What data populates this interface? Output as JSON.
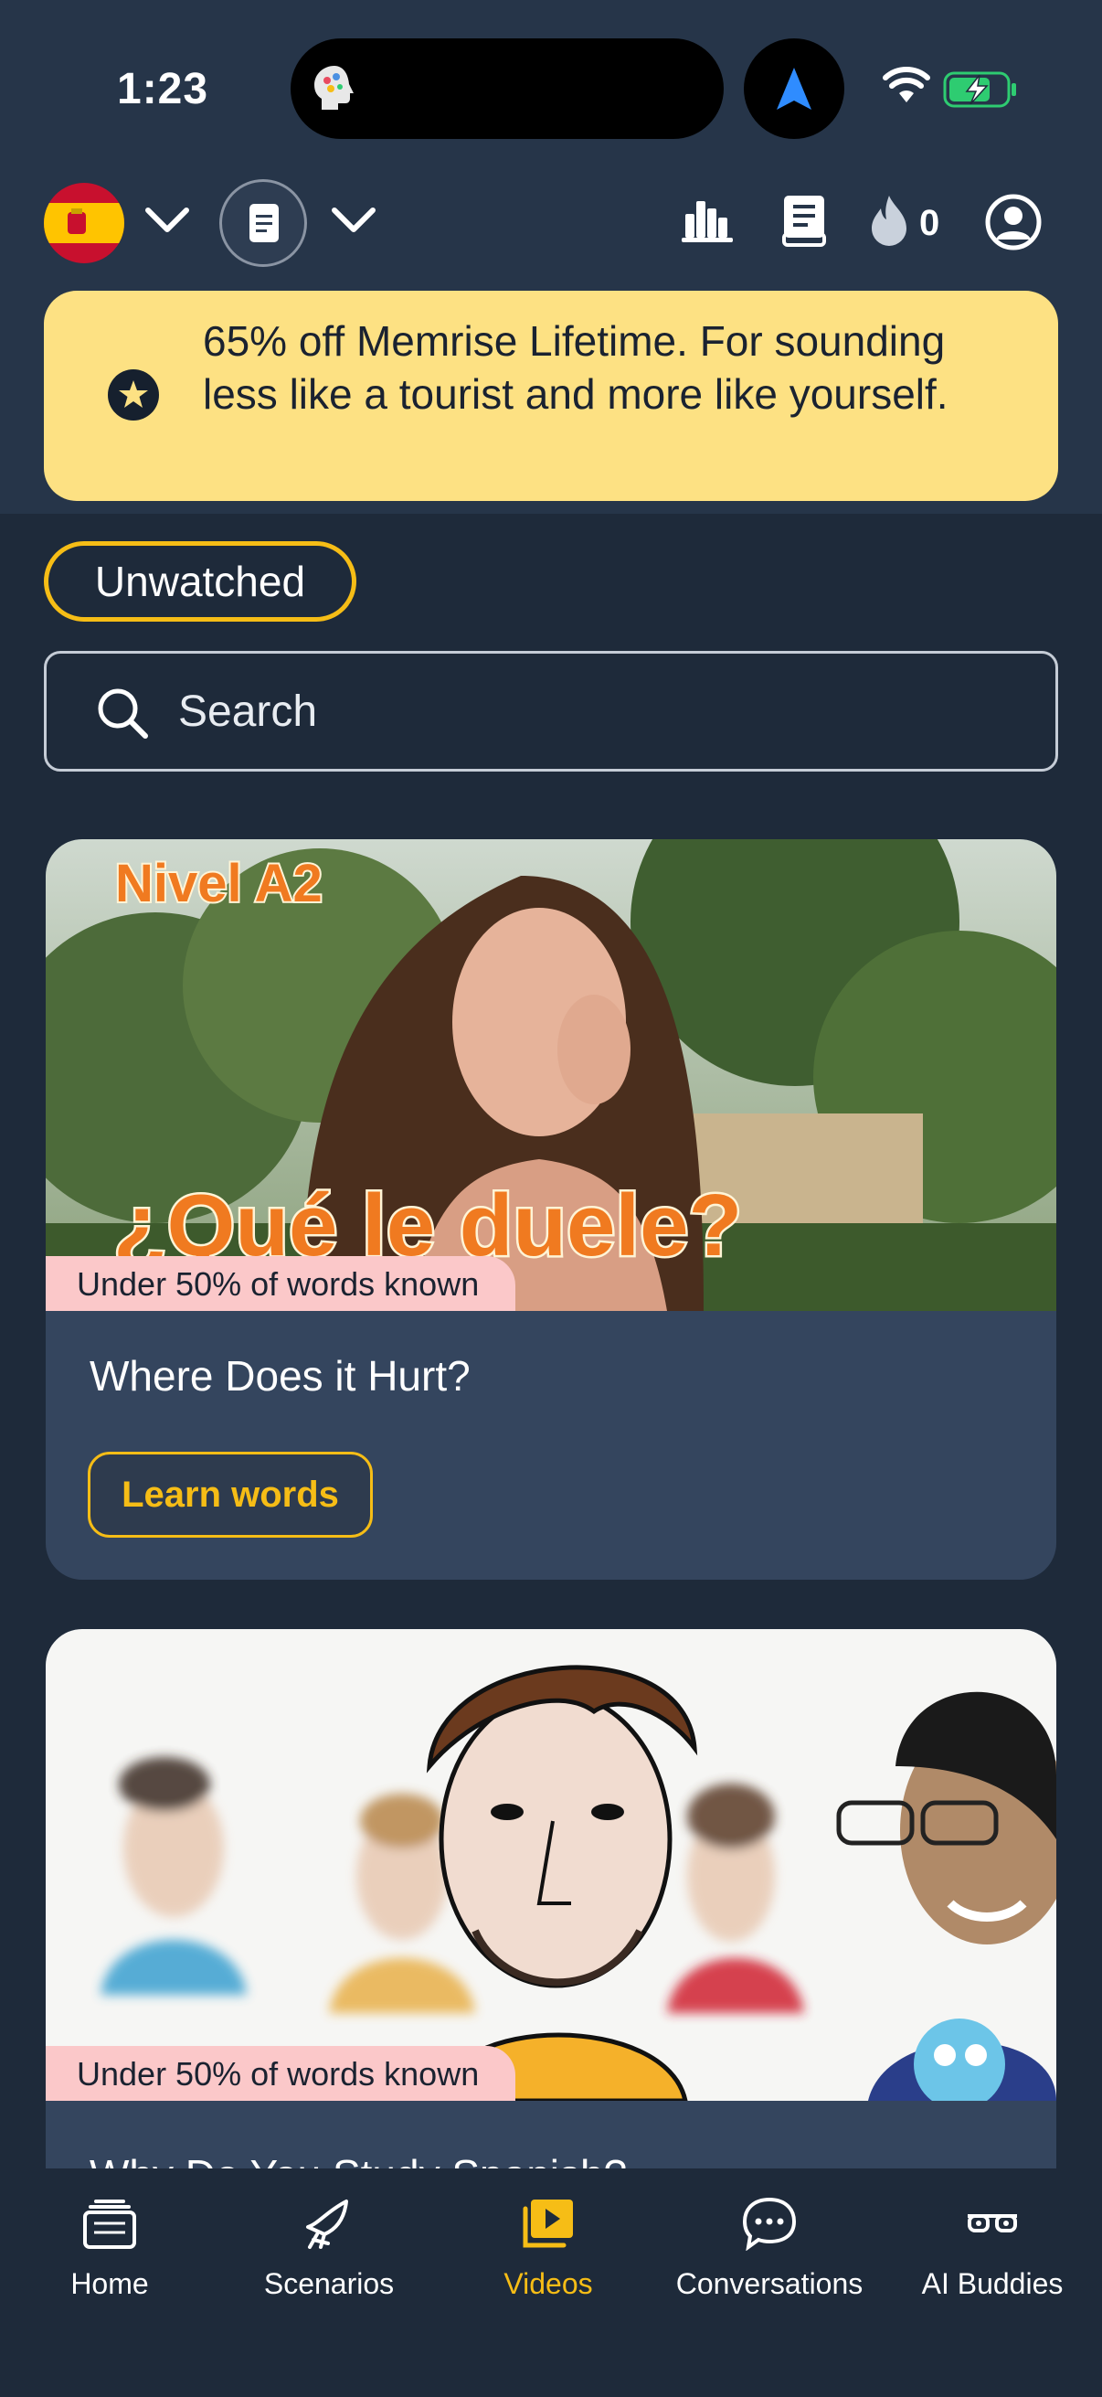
{
  "status_bar": {
    "time": "1:23"
  },
  "toolbar": {
    "streak_count": "0"
  },
  "promo": {
    "text": "65% off Memrise Lifetime. For sounding less like a tourist and more like yourself."
  },
  "filter": {
    "label": "Unwatched"
  },
  "search": {
    "placeholder": "Search"
  },
  "videos": [
    {
      "thumb_title": "¿Qué le duele?",
      "thumb_level": "Nivel A2",
      "badge": "Under 50% of words known",
      "title": "Where Does it Hurt?",
      "button": "Learn words"
    },
    {
      "badge": "Under 50% of words known",
      "title": "Why Do You Study Spanish?"
    }
  ],
  "nav": [
    {
      "label": "Home",
      "icon": "home-icon"
    },
    {
      "label": "Scenarios",
      "icon": "scenarios-icon"
    },
    {
      "label": "Videos",
      "icon": "videos-icon",
      "active": true
    },
    {
      "label": "Conversations",
      "icon": "chat-icon"
    },
    {
      "label": "AI Buddies",
      "icon": "glasses-icon"
    }
  ],
  "colors": {
    "background": "#1e2a3a",
    "header": "#263549",
    "card": "#34455e",
    "accent": "#f6bd16",
    "promo": "#fde183",
    "badge": "#fbc8c9"
  }
}
